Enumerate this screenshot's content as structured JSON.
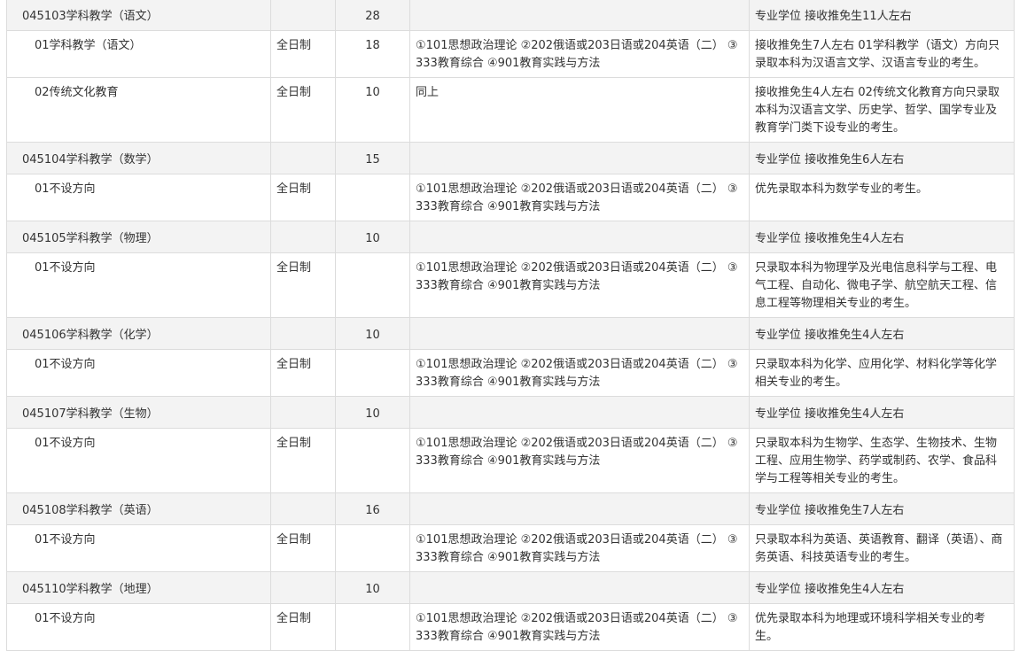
{
  "rows": [
    {
      "kind": "group",
      "name": "045103学科教学（语文）",
      "mode": "",
      "num": "28",
      "subjects": "",
      "note": "专业学位 接收推免生11人左右"
    },
    {
      "kind": "sub",
      "name": "01学科教学（语文）",
      "mode": "全日制",
      "num": "18",
      "subjects": "①101思想政治理论 ②202俄语或203日语或204英语（二） ③333教育综合 ④901教育实践与方法",
      "note": "接收推免生7人左右 01学科教学（语文）方向只录取本科为汉语言文学、汉语言专业的考生。"
    },
    {
      "kind": "sub",
      "name": "02传统文化教育",
      "mode": "全日制",
      "num": "10",
      "subjects": "同上",
      "note": "接收推免生4人左右 02传统文化教育方向只录取本科为汉语言文学、历史学、哲学、国学专业及教育学门类下设专业的考生。"
    },
    {
      "kind": "group",
      "name": "045104学科教学（数学）",
      "mode": "",
      "num": "15",
      "subjects": "",
      "note": "专业学位 接收推免生6人左右"
    },
    {
      "kind": "sub",
      "name": "01不设方向",
      "mode": "全日制",
      "num": "",
      "subjects": "①101思想政治理论 ②202俄语或203日语或204英语（二） ③333教育综合 ④901教育实践与方法",
      "note": "优先录取本科为数学专业的考生。"
    },
    {
      "kind": "group",
      "name": "045105学科教学（物理）",
      "mode": "",
      "num": "10",
      "subjects": "",
      "note": "专业学位 接收推免生4人左右"
    },
    {
      "kind": "sub",
      "name": "01不设方向",
      "mode": "全日制",
      "num": "",
      "subjects": "①101思想政治理论 ②202俄语或203日语或204英语（二） ③333教育综合 ④901教育实践与方法",
      "note": "只录取本科为物理学及光电信息科学与工程、电气工程、自动化、微电子学、航空航天工程、信息工程等物理相关专业的考生。"
    },
    {
      "kind": "group",
      "name": "045106学科教学（化学）",
      "mode": "",
      "num": "10",
      "subjects": "",
      "note": "专业学位 接收推免生4人左右"
    },
    {
      "kind": "sub",
      "name": "01不设方向",
      "mode": "全日制",
      "num": "",
      "subjects": "①101思想政治理论 ②202俄语或203日语或204英语（二） ③333教育综合 ④901教育实践与方法",
      "note": "只录取本科为化学、应用化学、材料化学等化学相关专业的考生。"
    },
    {
      "kind": "group",
      "name": "045107学科教学（生物）",
      "mode": "",
      "num": "10",
      "subjects": "",
      "note": "专业学位 接收推免生4人左右"
    },
    {
      "kind": "sub",
      "name": "01不设方向",
      "mode": "全日制",
      "num": "",
      "subjects": "①101思想政治理论 ②202俄语或203日语或204英语（二） ③333教育综合 ④901教育实践与方法",
      "note": "只录取本科为生物学、生态学、生物技术、生物工程、应用生物学、药学或制药、农学、食品科学与工程等相关专业的考生。"
    },
    {
      "kind": "group",
      "name": "045108学科教学（英语）",
      "mode": "",
      "num": "16",
      "subjects": "",
      "note": "专业学位 接收推免生7人左右"
    },
    {
      "kind": "sub",
      "name": "01不设方向",
      "mode": "全日制",
      "num": "",
      "subjects": "①101思想政治理论 ②202俄语或203日语或204英语（二） ③333教育综合 ④901教育实践与方法",
      "note": "只录取本科为英语、英语教育、翻译（英语）、商务英语、科技英语专业的考生。"
    },
    {
      "kind": "group",
      "name": "045110学科教学（地理）",
      "mode": "",
      "num": "10",
      "subjects": "",
      "note": "专业学位 接收推免生4人左右"
    },
    {
      "kind": "sub",
      "name": "01不设方向",
      "mode": "全日制",
      "num": "",
      "subjects": "①101思想政治理论 ②202俄语或203日语或204英语（二） ③333教育综合 ④901教育实践与方法",
      "note": "优先录取本科为地理或环境科学相关专业的考生。"
    }
  ]
}
